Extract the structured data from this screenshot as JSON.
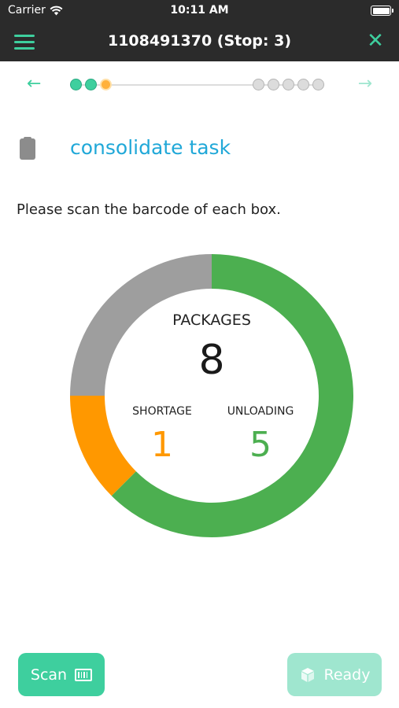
{
  "status_bar": {
    "carrier": "Carrier",
    "time": "10:11 AM"
  },
  "nav": {
    "title": "1108491370 (Stop: 3)"
  },
  "progress": {
    "done_steps": 2,
    "current_step": 3,
    "future_steps": 5
  },
  "task": {
    "title": "consolidate task"
  },
  "instruction": "Please scan the barcode of each box.",
  "summary": {
    "packages_label": "PACKAGES",
    "packages_value": "8",
    "shortage_label": "SHORTAGE",
    "shortage_value": "1",
    "unloading_label": "UNLOADING",
    "unloading_value": "5"
  },
  "donut": {
    "total": 8,
    "segments": [
      {
        "key": "unloading",
        "value": 5,
        "color": "#4caf50"
      },
      {
        "key": "shortage",
        "value": 1,
        "color": "#ff9800"
      },
      {
        "key": "remaining",
        "value": 2,
        "color": "#9e9e9e"
      }
    ]
  },
  "buttons": {
    "scan_label": "Scan",
    "ready_label": "Ready"
  },
  "colors": {
    "accent": "#3ecf9e",
    "accent_disabled": "#9fe6cf",
    "title_blue": "#20a8d8",
    "shortage": "#ff9800",
    "unloading": "#4caf50",
    "nav_bg": "#2b2b2b"
  },
  "icons": {
    "menu": "menu-icon",
    "close": "close-icon",
    "back": "arrow-left-icon",
    "forward": "arrow-right-icon",
    "task": "clipboard-icon",
    "scan": "barcode-icon",
    "ready": "cube-icon"
  }
}
